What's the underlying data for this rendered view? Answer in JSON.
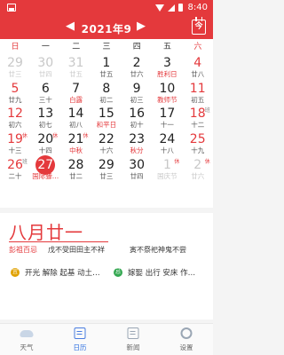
{
  "status_bar": {
    "time": "8:40"
  },
  "header": {
    "title": "2021年9月",
    "prev": "◀",
    "next": "▶",
    "today_label": "今"
  },
  "weekdays": [
    "日",
    "一",
    "二",
    "三",
    "四",
    "五",
    "六"
  ],
  "days": [
    {
      "s": "29",
      "l": "廿三",
      "other": true
    },
    {
      "s": "30",
      "l": "廿四",
      "other": true
    },
    {
      "s": "31",
      "l": "廿五",
      "other": true
    },
    {
      "s": "1",
      "l": "廿五"
    },
    {
      "s": "2",
      "l": "廿六"
    },
    {
      "s": "3",
      "l": "胜利日",
      "fest": true
    },
    {
      "s": "4",
      "l": "廿八",
      "we": true
    },
    {
      "s": "5",
      "l": "廿九",
      "we": true
    },
    {
      "s": "6",
      "l": "三十"
    },
    {
      "s": "7",
      "l": "白露",
      "fest": true
    },
    {
      "s": "8",
      "l": "初二"
    },
    {
      "s": "9",
      "l": "初三"
    },
    {
      "s": "10",
      "l": "教师节",
      "fest": true
    },
    {
      "s": "11",
      "l": "初五",
      "we": true
    },
    {
      "s": "12",
      "l": "初六",
      "we": true
    },
    {
      "s": "13",
      "l": "初七"
    },
    {
      "s": "14",
      "l": "初八"
    },
    {
      "s": "15",
      "l": "和平日",
      "fest": true
    },
    {
      "s": "16",
      "l": "初十"
    },
    {
      "s": "17",
      "l": "十一"
    },
    {
      "s": "18",
      "l": "十二",
      "we": true,
      "tag": "班"
    },
    {
      "s": "19",
      "l": "十三",
      "we": true,
      "tag": "休"
    },
    {
      "s": "20",
      "l": "十四",
      "tag": "休"
    },
    {
      "s": "21",
      "l": "中秋",
      "fest": true,
      "tag": "休"
    },
    {
      "s": "22",
      "l": "十六"
    },
    {
      "s": "23",
      "l": "秋分",
      "fest": true
    },
    {
      "s": "24",
      "l": "十八"
    },
    {
      "s": "25",
      "l": "十九",
      "we": true
    },
    {
      "s": "26",
      "l": "二十",
      "we": true,
      "tag": "班"
    },
    {
      "s": "27",
      "l": "国际聋…",
      "today": true
    },
    {
      "s": "28",
      "l": "廿二"
    },
    {
      "s": "29",
      "l": "廿三"
    },
    {
      "s": "30",
      "l": "廿四"
    },
    {
      "s": "1",
      "l": "国庆节",
      "other": true,
      "tag": "休"
    },
    {
      "s": "2",
      "l": "廿六",
      "other": true,
      "tag": "休"
    }
  ],
  "detail": {
    "lunar_date": "八月廿一",
    "taboo_label": "彭祖百忌",
    "taboo_1": "戊不受田田主不祥",
    "taboo_2": "寅不祭祀神鬼不尝",
    "yi_label": "宜",
    "yi_text": "开光 解除 起基 动土…",
    "ji_label": "忌",
    "ji_text": "嫁娶 出行 安床 作…"
  },
  "tabs": [
    {
      "label": "天气",
      "icon": "cloud-icon"
    },
    {
      "label": "日历",
      "icon": "calendar-icon",
      "active": true
    },
    {
      "label": "新闻",
      "icon": "news-icon"
    },
    {
      "label": "设置",
      "icon": "gear-icon"
    }
  ]
}
